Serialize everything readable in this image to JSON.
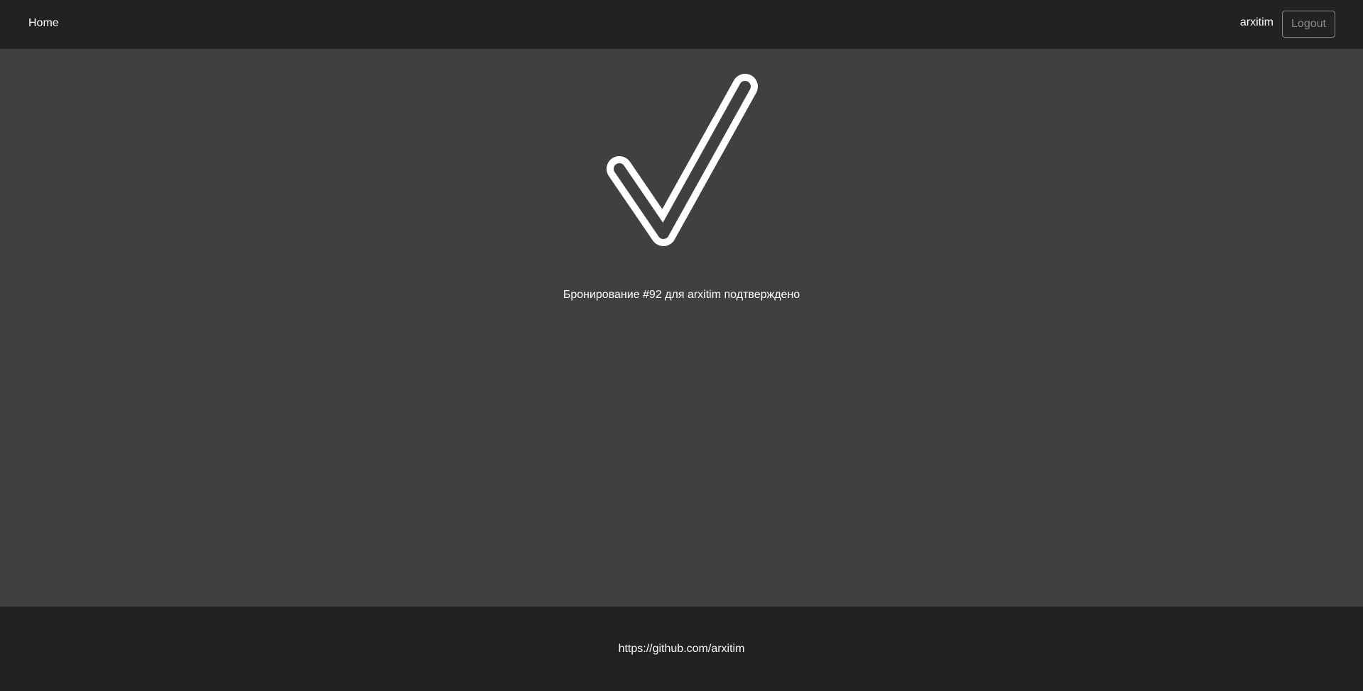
{
  "navbar": {
    "home_label": "Home",
    "username": "arxitim",
    "logout_label": "Logout"
  },
  "main": {
    "confirmation_text": "Бронирование #92 для arxitim подтверждено",
    "icon": "checkmark-icon"
  },
  "footer": {
    "link_text": "https://github.com/arxitim"
  },
  "colors": {
    "navbar_bg": "#222222",
    "main_bg": "#404040",
    "footer_bg": "#222222",
    "text": "#ffffff",
    "logout_outline": "#8a8a8a"
  }
}
